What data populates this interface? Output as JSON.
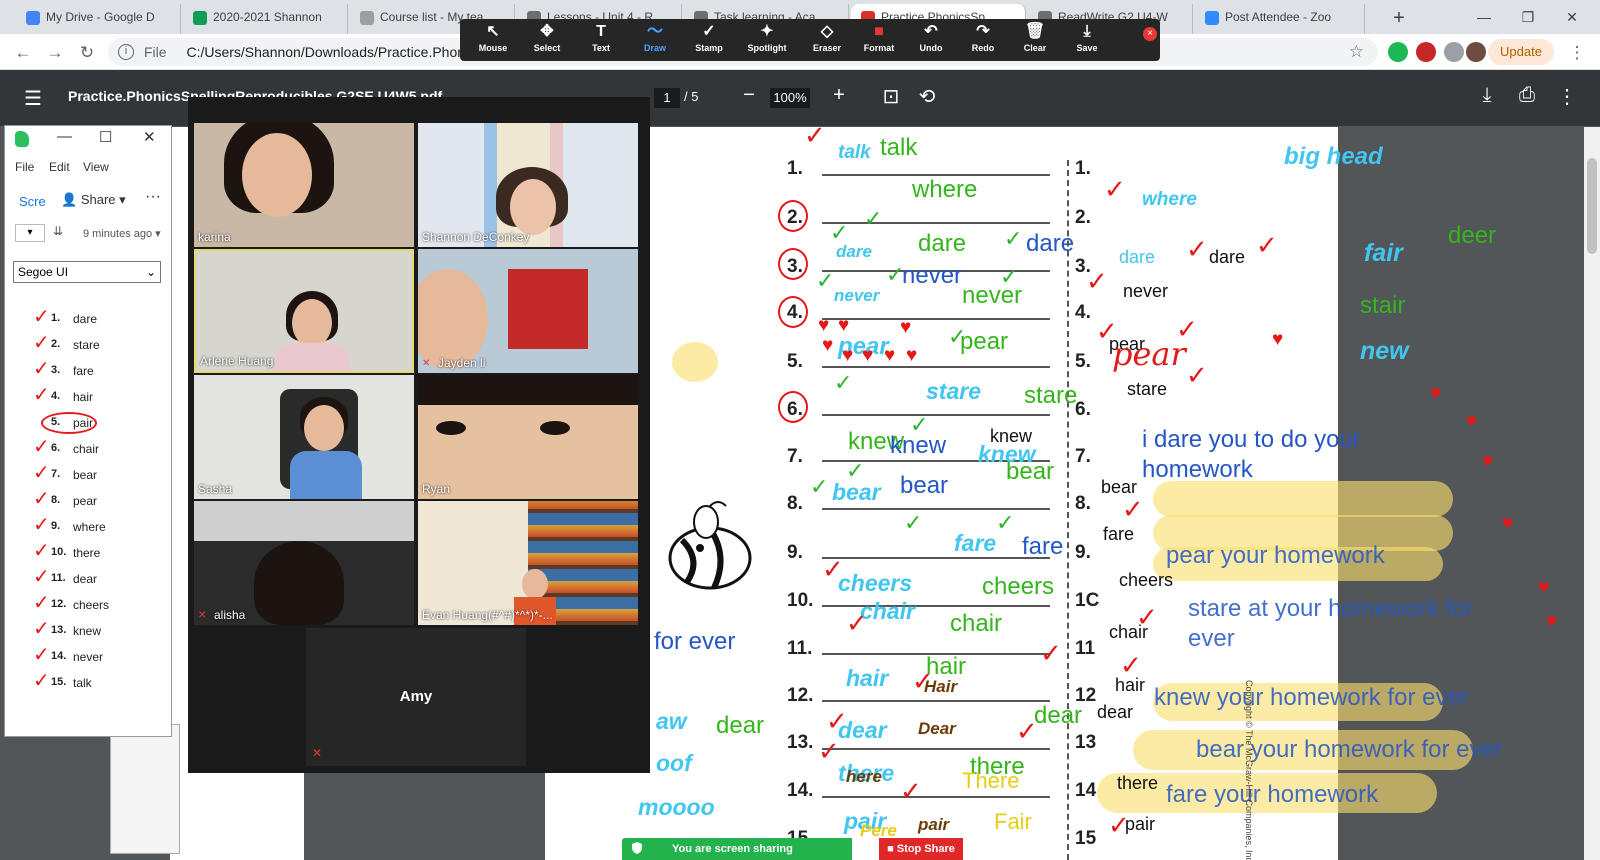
{
  "browser": {
    "tabs": [
      {
        "title": "My Drive - Google D",
        "color": "#4285f4"
      },
      {
        "title": "2020-2021 Shannon",
        "color": "#0f9d58"
      },
      {
        "title": "Course list - My tea",
        "color": "#9e9e9e"
      },
      {
        "title": "Lessons - Unit 4 - R",
        "color": "#6d6d6d"
      },
      {
        "title": "Task learning - Aca",
        "color": "#6d6d6d"
      },
      {
        "title": "Practice.PhonicsSp",
        "color": "#d93025"
      },
      {
        "title": "ReadWrite G2 U4-W",
        "color": "#6d6d6d"
      },
      {
        "title": "Post Attendee - Zoo",
        "color": "#2d8cff"
      }
    ],
    "new_tab_symbol": "+",
    "file_label": "File",
    "url": "C:/Users/Shannon/Downloads/Practice.Phonic",
    "update_label": "Update"
  },
  "annotate_toolbar": {
    "tools": [
      {
        "label": "Mouse",
        "icon": "↖"
      },
      {
        "label": "Select",
        "icon": "✥"
      },
      {
        "label": "Text",
        "icon": "T"
      },
      {
        "label": "Draw",
        "icon": "〜"
      },
      {
        "label": "Stamp",
        "icon": "✓"
      },
      {
        "label": "Spotlight",
        "icon": "✦"
      },
      {
        "label": "Eraser",
        "icon": "◇"
      },
      {
        "label": "Format",
        "icon": "■"
      },
      {
        "label": "Undo",
        "icon": "↶"
      },
      {
        "label": "Redo",
        "icon": "↷"
      },
      {
        "label": "Clear",
        "icon": "🗑"
      },
      {
        "label": "Save",
        "icon": "⤓"
      }
    ],
    "close_symbol": "×"
  },
  "pdf": {
    "title": "Practice.PhonicsSpellingReproducibles G2SE U4W5.pdf",
    "page_current": "1",
    "page_total": "/ 5",
    "zoom": "100%",
    "row_numbers": [
      "1.",
      "2.",
      "3.",
      "4.",
      "5.",
      "6.",
      "7.",
      "8.",
      "9.",
      "10.",
      "11.",
      "12.",
      "13.",
      "14.",
      "15."
    ],
    "right_numbers": [
      "1.",
      "2.",
      "3.",
      "4.",
      "5.",
      "6.",
      "7.",
      "8.",
      "9.",
      "1C",
      "11",
      "12",
      "13",
      "14",
      "15"
    ],
    "copyright": "Copyright © The McGraw-Hill Companies, Inc."
  },
  "annotations": {
    "cyan": [
      "talk",
      "where",
      "dare",
      "never",
      "pear",
      "stare",
      "knew",
      "bear",
      "fare",
      "cheers",
      "chair",
      "hair",
      "dear",
      "there",
      "pair",
      "big head",
      "dare",
      "fair",
      "new",
      "aw",
      "oof",
      "moooo"
    ],
    "green": [
      "talk",
      "where",
      "dare",
      "never",
      "never",
      "pear",
      "stare",
      "knew",
      "bear",
      "cheers",
      "chair",
      "hair",
      "dear",
      "there",
      "deer",
      "stair",
      "dear"
    ],
    "blue": [
      "dare",
      "never",
      "knew",
      "bear",
      "fare",
      "for ever",
      "i dare you to do your",
      "homework",
      "pear your homework",
      "stare at your homework for",
      "ever",
      "knew your homework for ever",
      "bear your homework for ever",
      "fare your homework"
    ],
    "black": [
      "knew",
      "dare",
      "never",
      "pear",
      "stare",
      "bear",
      "fare",
      "cheers",
      "chair",
      "hair",
      "dear",
      "there",
      "pair"
    ],
    "brown": [
      "Hair",
      "Dear",
      "here",
      "pair",
      "Pere"
    ],
    "yellow": [
      "There",
      "Fair"
    ],
    "red_writing": [
      "pear"
    ]
  },
  "evernote": {
    "menu": [
      "File",
      "Edit",
      "View"
    ],
    "scre_label": "Scre",
    "share_label": "Share",
    "time_label": "9 minutes ago",
    "font": "Segoe UI",
    "items": [
      {
        "n": "1.",
        "word": "dare"
      },
      {
        "n": "2.",
        "word": "stare"
      },
      {
        "n": "3.",
        "word": "fare"
      },
      {
        "n": "4.",
        "word": "hair"
      },
      {
        "n": "5.",
        "word": "pair"
      },
      {
        "n": "6.",
        "word": "chair"
      },
      {
        "n": "7.",
        "word": "bear"
      },
      {
        "n": "8.",
        "word": "pear"
      },
      {
        "n": "9.",
        "word": "where"
      },
      {
        "n": "10.",
        "word": "there"
      },
      {
        "n": "11.",
        "word": "dear"
      },
      {
        "n": "12.",
        "word": "cheers"
      },
      {
        "n": "13.",
        "word": "knew"
      },
      {
        "n": "14.",
        "word": "never"
      },
      {
        "n": "15.",
        "word": "talk"
      }
    ]
  },
  "zoom": {
    "participants": [
      "karina",
      "Shannon DeConkey",
      "Arlene Huang",
      "Jayden li",
      "Sasha",
      "Ryan",
      "alisha",
      "Evan Huang(#^#)*^*)*-..."
    ],
    "audio_only": "Amy",
    "sharing_text": "You are screen sharing",
    "stop_share": "Stop Share"
  }
}
